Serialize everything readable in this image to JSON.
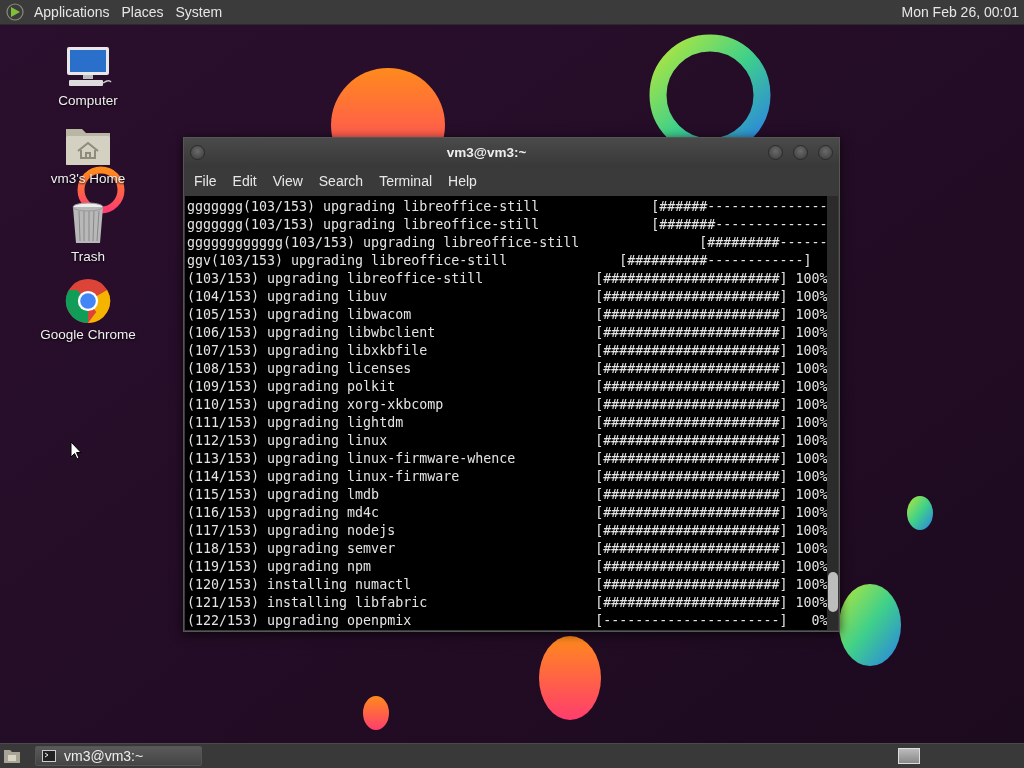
{
  "top_panel": {
    "menus": [
      "Applications",
      "Places",
      "System"
    ],
    "clock": "Mon Feb 26, 00:01"
  },
  "desktop_icons": [
    {
      "label": "Computer",
      "kind": "computer"
    },
    {
      "label": "vm3's Home",
      "kind": "home"
    },
    {
      "label": "Trash",
      "kind": "trash"
    },
    {
      "label": "Google Chrome",
      "kind": "browser"
    }
  ],
  "terminal": {
    "title": "vm3@vm3:~",
    "menu": [
      "File",
      "Edit",
      "View",
      "Search",
      "Terminal",
      "Help"
    ],
    "lines": [
      "ggggggg(103/153) upgrading libreoffice-still              [######---------------",
      "ggggggg(103/153) upgrading libreoffice-still              [#######--------------",
      "gggggggggggg(103/153) upgrading libreoffice-still               [#########------",
      "ggv(103/153) upgrading libreoffice-still              [##########------------]",
      "(103/153) upgrading libreoffice-still              [######################] 100%",
      "(104/153) upgrading libuv                          [######################] 100%",
      "(105/153) upgrading libwacom                       [######################] 100%",
      "(106/153) upgrading libwbclient                    [######################] 100%",
      "(107/153) upgrading libxkbfile                     [######################] 100%",
      "(108/153) upgrading licenses                       [######################] 100%",
      "(109/153) upgrading polkit                         [######################] 100%",
      "(110/153) upgrading xorg-xkbcomp                   [######################] 100%",
      "(111/153) upgrading lightdm                        [######################] 100%",
      "(112/153) upgrading linux                          [######################] 100%",
      "(113/153) upgrading linux-firmware-whence          [######################] 100%",
      "(114/153) upgrading linux-firmware                 [######################] 100%",
      "(115/153) upgrading lmdb                           [######################] 100%",
      "(116/153) upgrading md4c                           [######################] 100%",
      "(117/153) upgrading nodejs                         [######################] 100%",
      "(118/153) upgrading semver                         [######################] 100%",
      "(119/153) upgrading npm                            [######################] 100%",
      "(120/153) installing numactl                       [######################] 100%",
      "(121/153) installing libfabric                     [######################] 100%",
      "(122/153) upgrading openpmix                       [----------------------]   0%"
    ]
  },
  "taskbar": {
    "tasks": [
      "vm3@vm3:~"
    ]
  }
}
